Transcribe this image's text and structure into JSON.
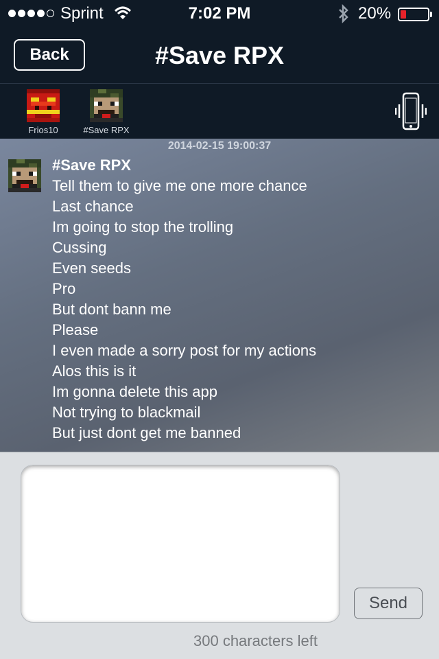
{
  "status_bar": {
    "signal_filled": 4,
    "signal_total": 5,
    "carrier": "Sprint",
    "time": "7:02 PM",
    "battery_percent": "20%",
    "battery_level": 0.2,
    "battery_color": "#e8222a",
    "icons": [
      "wifi-icon",
      "bluetooth-icon",
      "battery-icon"
    ]
  },
  "nav": {
    "back_label": "Back",
    "title": "#Save RPX"
  },
  "members": [
    {
      "name": "Frios10",
      "avatar": "red-pixel-avatar"
    },
    {
      "name": "#Save RPX",
      "avatar": "camo-pixel-avatar"
    }
  ],
  "vibrate_icon": "phone-vibrate-icon",
  "chat": {
    "timestamp": "2014-02-15 19:00:37",
    "message": {
      "sender": "#Save RPX",
      "lines": [
        "Tell them to give me one more chance",
        "Last chance",
        "Im going to stop the trolling",
        "Cussing",
        "Even seeds",
        "Pro",
        "But dont bann me",
        "Please",
        "I even made a sorry post for my actions",
        "Alos this is it",
        "Im gonna delete this app",
        "Not trying to blackmail",
        "But just dont get me banned"
      ]
    }
  },
  "composer": {
    "input_value": "",
    "send_label": "Send",
    "chars_left": "300 characters left"
  }
}
